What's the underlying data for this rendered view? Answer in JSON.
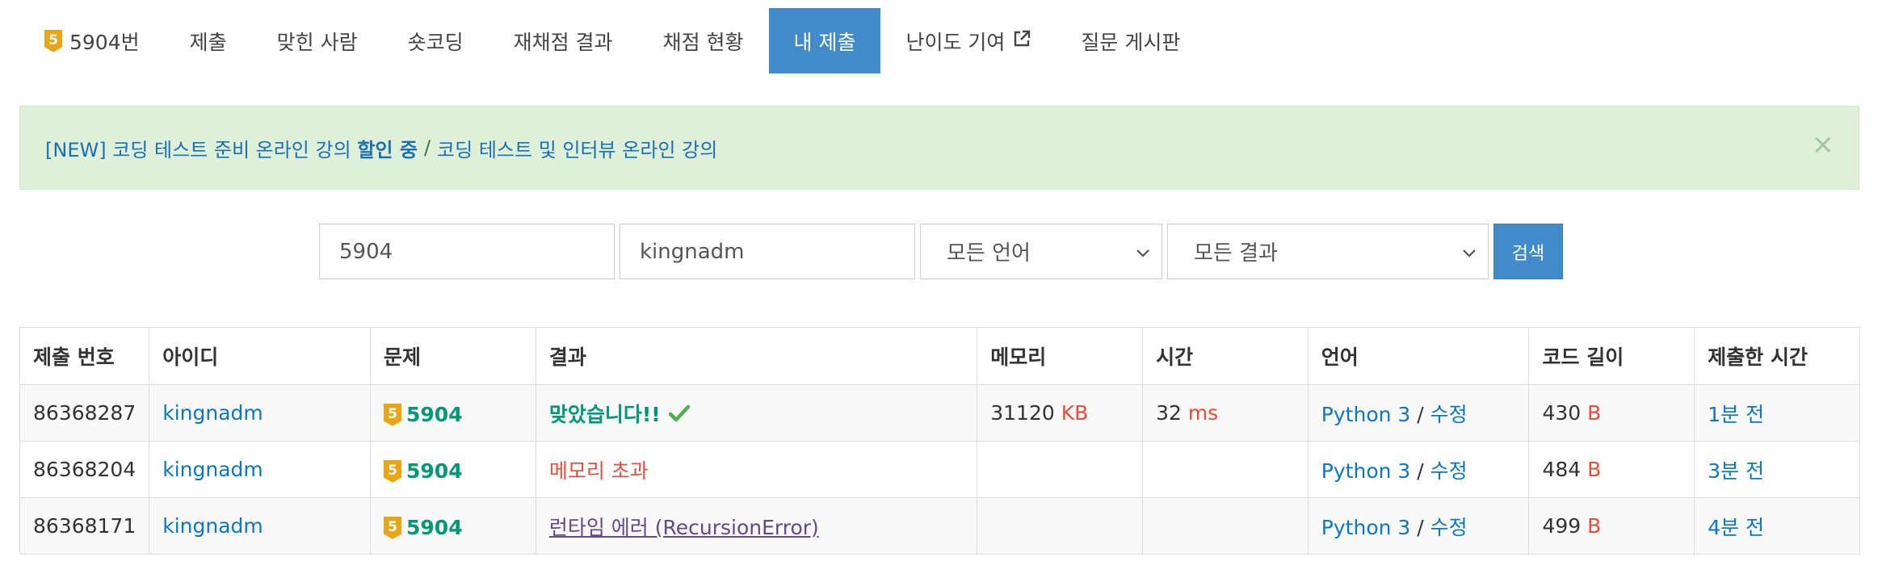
{
  "tabs": {
    "problem_tier": "5",
    "problem": "5904번",
    "submit": "제출",
    "solved": "맞힌 사람",
    "shortcoding": "숏코딩",
    "rejudge": "재채점 결과",
    "status": "채점 현황",
    "my_submissions": "내 제출",
    "difficulty": "난이도 기여",
    "board": "질문 게시판"
  },
  "alert": {
    "prefix": "[NEW] 코딩 테스트 준비 온라인 강의",
    "highlight": "할인 중",
    "separator": "/",
    "second_link": "코딩 테스트 및 인터뷰 온라인 강의",
    "close": "×"
  },
  "search": {
    "problem_id": "5904",
    "user_id": "kingnadm",
    "language": "모든 언어",
    "result": "모든 결과",
    "button": "검색"
  },
  "table": {
    "headers": [
      "제출 번호",
      "아이디",
      "문제",
      "결과",
      "메모리",
      "시간",
      "언어",
      "코드 길이",
      "제출한 시간"
    ],
    "rows": [
      {
        "id": "86368287",
        "user": "kingnadm",
        "tier": "5",
        "problem": "5904",
        "result": "맞았습니다!!",
        "memory": "31120",
        "memory_unit": "KB",
        "time": "32",
        "time_unit": "ms",
        "language": "Python 3",
        "lang_sep": "/",
        "edit": "수정",
        "length": "430",
        "length_unit": "B",
        "submitted": "1분 전"
      },
      {
        "id": "86368204",
        "user": "kingnadm",
        "tier": "5",
        "problem": "5904",
        "result": "메모리 초과",
        "memory": "",
        "memory_unit": "",
        "time": "",
        "time_unit": "",
        "language": "Python 3",
        "lang_sep": "/",
        "edit": "수정",
        "length": "484",
        "length_unit": "B",
        "submitted": "3분 전"
      },
      {
        "id": "86368171",
        "user": "kingnadm",
        "tier": "5",
        "problem": "5904",
        "result": "런타임 에러 (RecursionError)",
        "memory": "",
        "memory_unit": "",
        "time": "",
        "time_unit": "",
        "language": "Python 3",
        "lang_sep": "/",
        "edit": "수정",
        "length": "499",
        "length_unit": "B",
        "submitted": "4분 전"
      }
    ]
  },
  "colors": {
    "accent": "#428bca",
    "accepted": "#009874",
    "error": "#e74c3c",
    "link": "#0b76c6",
    "tier_bronze": "#e7a517"
  }
}
